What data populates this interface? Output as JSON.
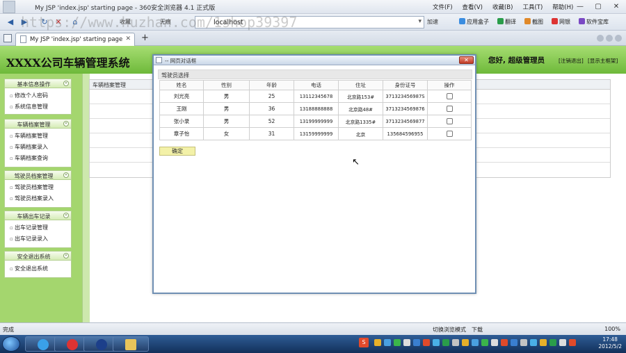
{
  "browser": {
    "window_title": "My JSP 'index.jsp' starting page - 360安全浏览器 4.1 正式版",
    "menus": [
      "文件(F)",
      "查看(V)",
      "收藏(B)",
      "工具(T)",
      "帮助(H)"
    ],
    "nav_labels": {
      "back": "收藏",
      "fav": "无痕"
    },
    "address": "localhost",
    "speed_label": "加速",
    "tools": [
      "应用盒子",
      "翻译",
      "截图",
      "网银",
      "软件宝库"
    ],
    "tab_title": "My JSP 'index.jsp' starting page",
    "status_text": "完成",
    "status_tools": [
      "切换浏览模式",
      "下载"
    ],
    "zoom": "100%"
  },
  "watermark": "https://www.huzhan.com/1shop39397",
  "page": {
    "system_title": "XXXX公司车辆管理系统",
    "greeting": "您好,   超级管理员",
    "header_links": [
      "[注销退出]",
      "[显示主框架]"
    ],
    "main_title": "车辆档案管理"
  },
  "sidebar": {
    "sections": [
      {
        "title": "基本信息操作",
        "items": [
          "修改个人密码",
          "系统信息管理"
        ]
      },
      {
        "title": "车辆档案管理",
        "items": [
          "车辆档案管理",
          "车辆档案录入",
          "车辆档案查询"
        ]
      },
      {
        "title": "驾驶员档案管理",
        "items": [
          "驾驶员档案管理",
          "驾驶员档案录入"
        ]
      },
      {
        "title": "车辆出车记录",
        "items": [
          "出车记录管理",
          "出车记录录入"
        ]
      },
      {
        "title": "安全退出系统",
        "items": [
          "安全退出系统"
        ]
      }
    ]
  },
  "dialog": {
    "title": "-- 网页对话框",
    "legend": "驾驶员选择",
    "columns": [
      "姓名",
      "性别",
      "年龄",
      "电话",
      "住址",
      "身份证号",
      "操作"
    ],
    "rows": [
      [
        "刘光亮",
        "男",
        "25",
        "13112345678",
        "北京路153#",
        "371323456987S"
      ],
      [
        "王刚",
        "男",
        "36",
        "13188888888",
        "北京路48#",
        "3713234569876"
      ],
      [
        "张小录",
        "男",
        "52",
        "13199999999",
        "北京路1335#",
        "3713234569877"
      ],
      [
        "章子怡",
        "女",
        "31",
        "13159999999",
        "北京",
        "135684596955"
      ]
    ],
    "ok_label": "确定"
  },
  "taskbar": {
    "time": "17:48",
    "date": "2012/5/2",
    "s_label": "S"
  }
}
